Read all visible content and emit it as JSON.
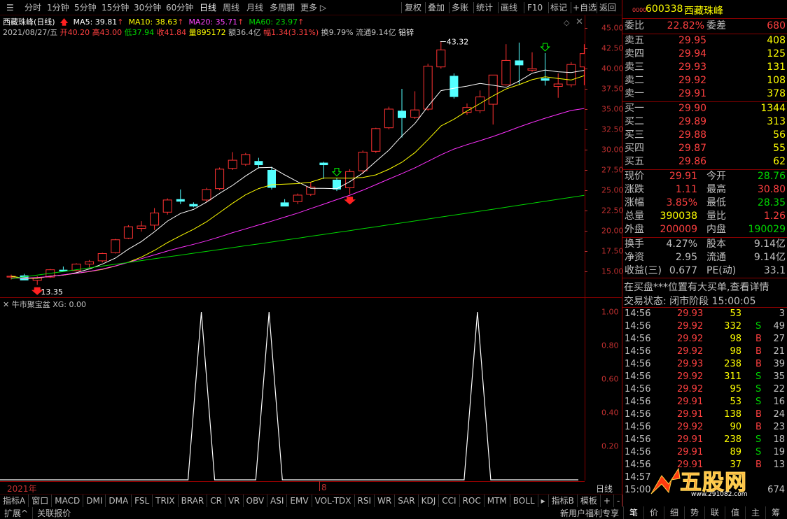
{
  "toolbar": {
    "periods": [
      "分时",
      "1分钟",
      "5分钟",
      "15分钟",
      "30分钟",
      "60分钟",
      "日线",
      "周线",
      "月线",
      "多周期",
      "更多 ▷"
    ],
    "active": "日线",
    "buttons": [
      "复权",
      "叠加",
      "多账",
      "统计",
      "画线",
      "F10",
      "标记",
      "+自选",
      "返回"
    ]
  },
  "chart_title": "西藏珠峰(日线)",
  "ma": {
    "ma5": "MA5: 39.81",
    "ma10": "MA10: 38.63",
    "ma20": "MA20: 35.71",
    "ma60": "MA60: 23.97"
  },
  "day_info": {
    "date": "2021/08/27/五",
    "open": "开40.20",
    "high": "高43.00",
    "low": "低37.94",
    "close": "收41.84",
    "vol": "量895172",
    "amt": "额36.4亿",
    "range": "幅1.34(3.31%)",
    "turn": "换9.79%",
    "float": "流通9.14亿",
    "sector": "铅锌"
  },
  "annotations": {
    "high": "43.32",
    "low": "13.35"
  },
  "price_axis": [
    "45.00",
    "42.50",
    "40.00",
    "37.50",
    "35.00",
    "32.50",
    "30.00",
    "27.50",
    "25.00",
    "22.50",
    "20.00",
    "17.50",
    "15.00"
  ],
  "ind_title": "牛市聚宝盆",
  "ind_xg": "XG: 0.00",
  "ind_axis": [
    "1.00",
    "0.80",
    "0.60",
    "0.40",
    "0.20"
  ],
  "x_labels": {
    "year": "2021年",
    "month": "8",
    "period": "日线"
  },
  "chart_data": {
    "type": "candlestick",
    "points": [
      {
        "open": 14.3,
        "high": 14.6,
        "low": 14.0,
        "close": 14.4
      },
      {
        "open": 14.5,
        "high": 14.7,
        "low": 13.9,
        "close": 13.9
      },
      {
        "open": 13.9,
        "high": 14.4,
        "low": 13.35,
        "close": 14.2
      },
      {
        "open": 14.3,
        "high": 15.3,
        "low": 14.2,
        "close": 15.2
      },
      {
        "open": 15.2,
        "high": 15.6,
        "low": 15.0,
        "close": 15.0
      },
      {
        "open": 15.1,
        "high": 16.0,
        "low": 15.0,
        "close": 15.9
      },
      {
        "open": 15.9,
        "high": 16.4,
        "low": 15.5,
        "close": 16.2
      },
      {
        "open": 16.3,
        "high": 17.3,
        "low": 16.1,
        "close": 17.2
      },
      {
        "open": 17.3,
        "high": 19.0,
        "low": 17.2,
        "close": 18.9
      },
      {
        "open": 19.1,
        "high": 20.7,
        "low": 19.0,
        "close": 20.5
      },
      {
        "open": 20.3,
        "high": 21.2,
        "low": 19.9,
        "close": 20.6
      },
      {
        "open": 20.7,
        "high": 22.8,
        "low": 20.1,
        "close": 22.2
      },
      {
        "open": 22.3,
        "high": 24.0,
        "low": 22.0,
        "close": 23.8
      },
      {
        "open": 23.9,
        "high": 25.1,
        "low": 23.3,
        "close": 23.6
      },
      {
        "open": 23.3,
        "high": 23.5,
        "low": 22.9,
        "close": 23.0
      },
      {
        "open": 23.8,
        "high": 25.3,
        "low": 23.5,
        "close": 25.1
      },
      {
        "open": 25.2,
        "high": 27.8,
        "low": 25.0,
        "close": 27.6
      },
      {
        "open": 27.7,
        "high": 29.7,
        "low": 27.5,
        "close": 28.7
      },
      {
        "open": 28.2,
        "high": 29.6,
        "low": 28.0,
        "close": 29.4
      },
      {
        "open": 28.6,
        "high": 29.0,
        "low": 27.7,
        "close": 28.1
      },
      {
        "open": 27.5,
        "high": 27.9,
        "low": 25.1,
        "close": 25.3
      },
      {
        "open": 23.5,
        "high": 23.9,
        "low": 23.0,
        "close": 23.0
      },
      {
        "open": 23.6,
        "high": 24.6,
        "low": 23.3,
        "close": 24.4
      },
      {
        "open": 24.5,
        "high": 26.0,
        "low": 24.3,
        "close": 25.4
      },
      {
        "open": 28.4,
        "high": 28.5,
        "low": 26.4,
        "close": 28.1
      },
      {
        "open": 26.3,
        "high": 26.5,
        "low": 24.9,
        "close": 25.1
      },
      {
        "open": 25.3,
        "high": 27.6,
        "low": 24.5,
        "close": 27.3
      },
      {
        "open": 27.4,
        "high": 29.9,
        "low": 27.0,
        "close": 29.7
      },
      {
        "open": 29.8,
        "high": 32.7,
        "low": 29.6,
        "close": 32.6
      },
      {
        "open": 32.7,
        "high": 35.3,
        "low": 32.5,
        "close": 35.0
      },
      {
        "open": 34.8,
        "high": 37.5,
        "low": 31.5,
        "close": 33.9
      },
      {
        "open": 34.0,
        "high": 37.2,
        "low": 33.8,
        "close": 34.9
      },
      {
        "open": 35.0,
        "high": 40.6,
        "low": 34.8,
        "close": 40.3
      },
      {
        "open": 40.2,
        "high": 43.32,
        "low": 40.0,
        "close": 42.3
      },
      {
        "open": 39.1,
        "high": 39.4,
        "low": 36.3,
        "close": 36.5
      },
      {
        "open": 34.6,
        "high": 35.7,
        "low": 34.3,
        "close": 35.2
      },
      {
        "open": 34.8,
        "high": 37.3,
        "low": 34.5,
        "close": 36.5
      },
      {
        "open": 35.6,
        "high": 37.2,
        "low": 33.1,
        "close": 39.2
      },
      {
        "open": 38.0,
        "high": 43.0,
        "low": 37.9,
        "close": 41.0
      },
      {
        "open": 41.0,
        "high": 43.2,
        "low": 38.0,
        "close": 40.4
      },
      {
        "open": 39.8,
        "high": 42.0,
        "low": 39.6,
        "close": 40.0
      },
      {
        "open": 38.8,
        "high": 41.9,
        "low": 37.9,
        "close": 38.5
      },
      {
        "open": 37.8,
        "high": 39.4,
        "low": 36.4,
        "close": 38.1
      },
      {
        "open": 38.0,
        "high": 40.8,
        "low": 37.7,
        "close": 40.5
      },
      {
        "open": 40.2,
        "high": 43.0,
        "low": 37.94,
        "close": 41.84
      }
    ]
  },
  "quote": {
    "code": "600338",
    "name": "西藏珠峰",
    "webi": {
      "l": "委比",
      "v": "22.82%",
      "l2": "委差",
      "v2": "680"
    },
    "asks": [
      {
        "l": "卖五",
        "p": "29.95",
        "q": "408"
      },
      {
        "l": "卖四",
        "p": "29.94",
        "q": "125"
      },
      {
        "l": "卖三",
        "p": "29.93",
        "q": "131"
      },
      {
        "l": "卖二",
        "p": "29.92",
        "q": "108"
      },
      {
        "l": "卖一",
        "p": "29.91",
        "q": "378"
      }
    ],
    "bids": [
      {
        "l": "买一",
        "p": "29.90",
        "q": "1344"
      },
      {
        "l": "买二",
        "p": "29.89",
        "q": "313"
      },
      {
        "l": "买三",
        "p": "29.88",
        "q": "56"
      },
      {
        "l": "买四",
        "p": "29.87",
        "q": "55"
      },
      {
        "l": "买五",
        "p": "29.86",
        "q": "62"
      }
    ],
    "stats": [
      {
        "l": "现价",
        "v": "29.91",
        "l2": "今开",
        "v2": "28.76",
        "c1": "red",
        "c2": "grn"
      },
      {
        "l": "涨跌",
        "v": "1.11",
        "l2": "最高",
        "v2": "30.80",
        "c1": "red",
        "c2": "red"
      },
      {
        "l": "涨幅",
        "v": "3.85%",
        "l2": "最低",
        "v2": "28.35",
        "c1": "red",
        "c2": "grn"
      },
      {
        "l": "总量",
        "v": "390038",
        "l2": "量比",
        "v2": "1.26",
        "c1": "yel",
        "c2": "red"
      },
      {
        "l": "外盘",
        "v": "200009",
        "l2": "内盘",
        "v2": "190029",
        "c1": "red",
        "c2": "grn"
      }
    ],
    "stats2": [
      {
        "l": "换手",
        "v": "4.27%",
        "l2": "股本",
        "v2": "9.14亿"
      },
      {
        "l": "净资",
        "v": "2.95",
        "l2": "流通",
        "v2": "9.14亿"
      },
      {
        "l": "收益(三)",
        "v": "0.677",
        "l2": "PE(动)",
        "v2": "33.1"
      }
    ],
    "notice": "在买盘***位置有大买单,查看详情",
    "status": "交易状态: 闭市阶段 15:00:05",
    "ticks": [
      {
        "t": "14:56",
        "p": "29.93",
        "q": "53",
        "s": "",
        "n": "3"
      },
      {
        "t": "14:56",
        "p": "29.92",
        "q": "332",
        "s": "S",
        "n": "49"
      },
      {
        "t": "14:56",
        "p": "29.92",
        "q": "98",
        "s": "B",
        "n": "27"
      },
      {
        "t": "14:56",
        "p": "29.92",
        "q": "98",
        "s": "B",
        "n": "21"
      },
      {
        "t": "14:56",
        "p": "29.93",
        "q": "238",
        "s": "B",
        "n": "39"
      },
      {
        "t": "14:56",
        "p": "29.92",
        "q": "311",
        "s": "S",
        "n": "35"
      },
      {
        "t": "14:56",
        "p": "29.92",
        "q": "95",
        "s": "S",
        "n": "22"
      },
      {
        "t": "14:56",
        "p": "29.91",
        "q": "53",
        "s": "S",
        "n": "16"
      },
      {
        "t": "14:56",
        "p": "29.91",
        "q": "138",
        "s": "B",
        "n": "24"
      },
      {
        "t": "14:56",
        "p": "29.92",
        "q": "90",
        "s": "B",
        "n": "23"
      },
      {
        "t": "14:56",
        "p": "29.91",
        "q": "238",
        "s": "S",
        "n": "18"
      },
      {
        "t": "14:56",
        "p": "29.91",
        "q": "89",
        "s": "S",
        "n": "19"
      },
      {
        "t": "14:56",
        "p": "29.91",
        "q": "37",
        "s": "B",
        "n": "13"
      },
      {
        "t": "14:57",
        "p": "",
        "q": "",
        "s": "",
        "n": ""
      },
      {
        "t": "15:00",
        "p": "",
        "q": "",
        "s": "",
        "n": "674"
      }
    ]
  },
  "bottom_tabs": [
    "指标A",
    "窗口",
    "MACD",
    "DMI",
    "DMA",
    "FSL",
    "TRIX",
    "BRAR",
    "CR",
    "VR",
    "OBV",
    "ASI",
    "EMV",
    "VOL-TDX",
    "RSI",
    "WR",
    "SAR",
    "KDJ",
    "CCI",
    "ROC",
    "MTM",
    "BOLL",
    "▸",
    "指标B",
    "模板",
    "+",
    "-"
  ],
  "status_bar": {
    "left1": "扩展^",
    "left2": "关联报价",
    "right": "新用户福利专享",
    "tabs": [
      "笔",
      "价",
      "细",
      "势",
      "联",
      "值",
      "主",
      "筹"
    ]
  },
  "watermark": "五股网",
  "watermark_url": "www.291082.com"
}
